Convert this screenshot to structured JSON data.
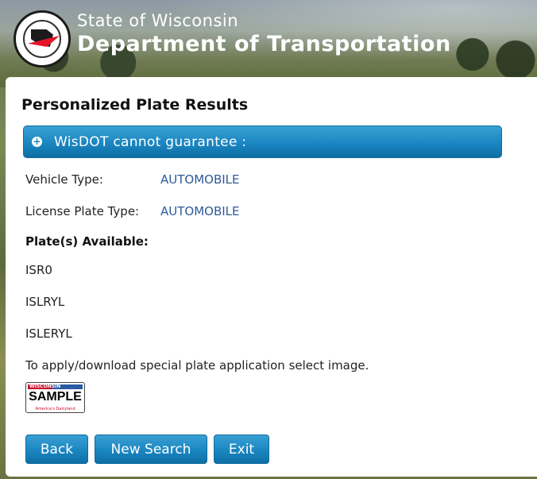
{
  "header": {
    "state": "State of Wisconsin",
    "department": "Department of Transportation"
  },
  "page": {
    "title": "Personalized Plate Results"
  },
  "notice": {
    "text": "WisDOT cannot guarantee :"
  },
  "details": {
    "vehicle_type_label": "Vehicle Type:",
    "vehicle_type_value": "AUTOMOBILE",
    "plate_type_label": "License Plate Type:",
    "plate_type_value": "AUTOMOBILE",
    "available_label": "Plate(s) Available:"
  },
  "plates": [
    "ISR0",
    "ISLRYL",
    "ISLERYL"
  ],
  "apply_text": "To apply/download special plate application select image.",
  "sample_plate": {
    "brand": "WISCONSIN",
    "text": "SAMPLE",
    "tagline": "America's Dairyland"
  },
  "buttons": {
    "back": "Back",
    "new_search": "New Search",
    "exit": "Exit"
  }
}
